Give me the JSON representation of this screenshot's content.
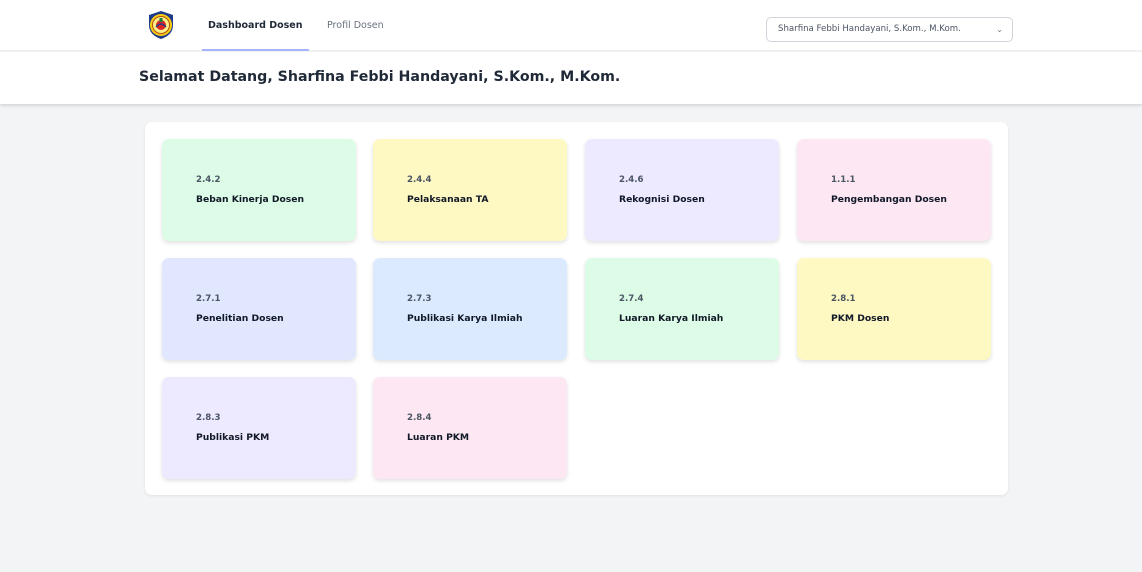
{
  "nav": {
    "logo": "university-crest",
    "links": [
      {
        "label": "Dashboard Dosen",
        "active": true
      },
      {
        "label": "Profil Dosen",
        "active": false
      }
    ],
    "user_menu": {
      "label": "Sharfina Febbi Handayani, S.Kom., M.Kom.",
      "icon": "chevron-down-icon"
    }
  },
  "header": {
    "title": "Selamat Datang, Sharfina Febbi Handayani, S.Kom., M.Kom."
  },
  "cards": [
    {
      "code": "2.4.2",
      "label": "Beban Kinerja Dosen",
      "color": "#dcfce7"
    },
    {
      "code": "2.4.4",
      "label": "Pelaksanaan TA",
      "color": "#fef9c3"
    },
    {
      "code": "2.4.6",
      "label": "Rekognisi Dosen",
      "color": "#ede9fe"
    },
    {
      "code": "1.1.1",
      "label": "Pengembangan Dosen",
      "color": "#fce7f3"
    },
    {
      "code": "2.7.1",
      "label": "Penelitian Dosen",
      "color": "#e0e7ff"
    },
    {
      "code": "2.7.3",
      "label": "Publikasi Karya Ilmiah",
      "color": "#dbeafe"
    },
    {
      "code": "2.7.4",
      "label": "Luaran Karya Ilmiah",
      "color": "#dcfce7"
    },
    {
      "code": "2.8.1",
      "label": "PKM Dosen",
      "color": "#fef9c3"
    },
    {
      "code": "2.8.3",
      "label": "Publikasi PKM",
      "color": "#ede9fe"
    },
    {
      "code": "2.8.4",
      "label": "Luaran PKM",
      "color": "#fce7f3"
    }
  ]
}
